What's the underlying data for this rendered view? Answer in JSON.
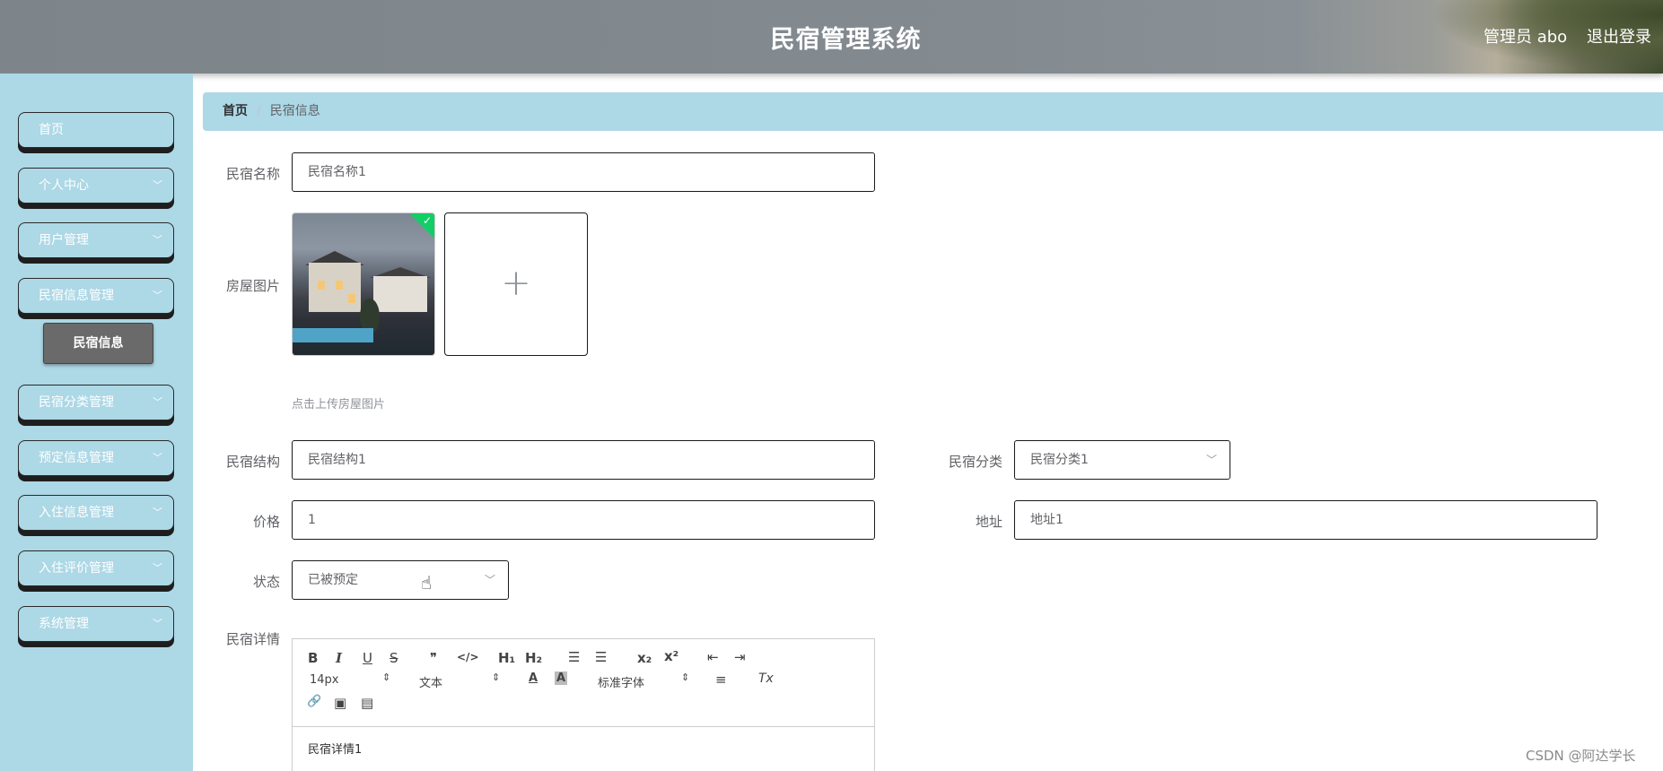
{
  "header": {
    "title": "民宿管理系统",
    "admin_label": "管理员 abo",
    "logout_label": "退出登录"
  },
  "sidebar": {
    "items": [
      {
        "label": "首页",
        "has_chevron": false
      },
      {
        "label": "个人中心",
        "has_chevron": true
      },
      {
        "label": "用户管理",
        "has_chevron": true
      },
      {
        "label": "民宿信息管理",
        "has_chevron": true
      },
      {
        "label": "民宿分类管理",
        "has_chevron": true
      },
      {
        "label": "预定信息管理",
        "has_chevron": true
      },
      {
        "label": "入住信息管理",
        "has_chevron": true
      },
      {
        "label": "入住评价管理",
        "has_chevron": true
      },
      {
        "label": "系统管理",
        "has_chevron": true
      }
    ],
    "sub_item": "民宿信息",
    "chevron_icon": "chevron-down-icon"
  },
  "breadcrumb": {
    "home": "首页",
    "separator": "/",
    "current": "民宿信息"
  },
  "form": {
    "name_label": "民宿名称",
    "name_value": "民宿名称1",
    "image_label": "房屋图片",
    "upload_tip": "点击上传房屋图片",
    "upload_plus": "+",
    "check_mark": "✓",
    "structure_label": "民宿结构",
    "structure_value": "民宿结构1",
    "category_label": "民宿分类",
    "category_value": "民宿分类1",
    "price_label": "价格",
    "price_value": "1",
    "address_label": "地址",
    "address_value": "地址1",
    "status_label": "状态",
    "status_value": "已被预定",
    "detail_label": "民宿详情"
  },
  "editor": {
    "toolbar": {
      "bold": "B",
      "italic": "I",
      "underline": "U",
      "strike": "S",
      "quote": "❞",
      "code": "</>",
      "h1": "H₁",
      "h2": "H₂",
      "ordered_list": "☰",
      "bullet_list": "☰",
      "subscript": "x₂",
      "superscript": "x²",
      "outdent": "⇤",
      "indent": "⇥",
      "font_size": "14px",
      "text_type": "文本",
      "font_color": "A",
      "bg_color": "A",
      "font_family": "标准字体",
      "align": "≡",
      "clean": "Tx",
      "link": "🔗",
      "image": "▣",
      "video": "▤"
    },
    "content": "民宿详情1"
  },
  "watermark": "CSDN @阿达学长",
  "colors": {
    "sidebar_bg": "#add8e6",
    "active_sub_bg": "#6a6a6a",
    "success_green": "#13ce66"
  }
}
